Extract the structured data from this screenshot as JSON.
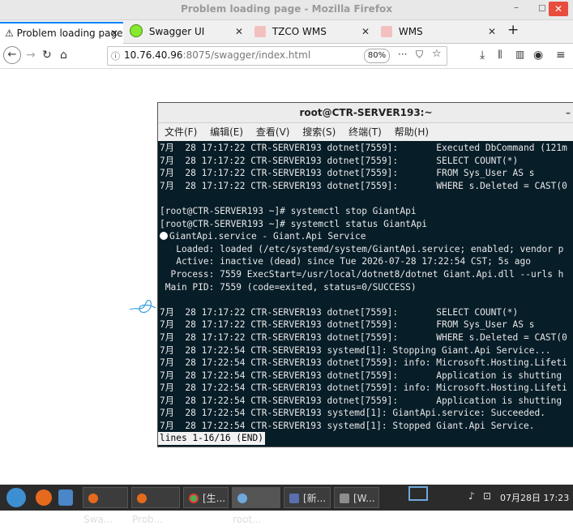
{
  "window": {
    "title": "Problem loading page - Mozilla Firefox",
    "close": "✕",
    "min": "–",
    "max": "◻"
  },
  "tabs": [
    {
      "label": "Problem loading page",
      "icon": "warning-icon",
      "active": true
    },
    {
      "label": "Swagger UI",
      "icon": "swagger-icon",
      "active": false
    },
    {
      "label": "TZCO WMS",
      "icon": "page-icon",
      "active": false
    },
    {
      "label": "WMS",
      "icon": "page-icon",
      "active": false
    }
  ],
  "tab_close": "✕",
  "new_tab": "+",
  "nav": {
    "url_host": "10.76.40.96",
    "url_rest": ":8075/swagger/index.html",
    "zoom": "80%",
    "more": "···"
  },
  "terminal": {
    "title": "root@CTR-SERVER193:~",
    "min": "–",
    "menu": [
      "文件(F)",
      "编辑(E)",
      "查看(V)",
      "搜索(S)",
      "终端(T)",
      "帮助(H)"
    ],
    "lines": [
      "7月  28 17:17:22 CTR-SERVER193 dotnet[7559]:       Executed DbCommand (121m",
      "7月  28 17:17:22 CTR-SERVER193 dotnet[7559]:       SELECT COUNT(*)",
      "7月  28 17:17:22 CTR-SERVER193 dotnet[7559]:       FROM Sys_User AS s",
      "7月  28 17:17:22 CTR-SERVER193 dotnet[7559]:       WHERE s.Deleted = CAST(0",
      "",
      "[root@CTR-SERVER193 ~]# systemctl stop GiantApi",
      "[root@CTR-SERVER193 ~]# systemctl status GiantApi",
      "GiantApi.service - Giant.Api Service",
      "   Loaded: loaded (/etc/systemd/system/GiantApi.service; enabled; vendor p",
      "   Active: inactive (dead) since Tue 2026-07-28 17:22:54 CST; 5s ago",
      "  Process: 7559 ExecStart=/usr/local/dotnet8/dotnet Giant.Api.dll --urls h",
      " Main PID: 7559 (code=exited, status=0/SUCCESS)",
      "",
      "7月  28 17:17:22 CTR-SERVER193 dotnet[7559]:       SELECT COUNT(*)",
      "7月  28 17:17:22 CTR-SERVER193 dotnet[7559]:       FROM Sys_User AS s",
      "7月  28 17:17:22 CTR-SERVER193 dotnet[7559]:       WHERE s.Deleted = CAST(0",
      "7月  28 17:22:54 CTR-SERVER193 systemd[1]: Stopping Giant.Api Service...",
      "7月  28 17:22:54 CTR-SERVER193 dotnet[7559]: info: Microsoft.Hosting.Lifeti",
      "7月  28 17:22:54 CTR-SERVER193 dotnet[7559]:       Application is shutting",
      "7月  28 17:22:54 CTR-SERVER193 dotnet[7559]: info: Microsoft.Hosting.Lifeti",
      "7月  28 17:22:54 CTR-SERVER193 dotnet[7559]:       Application is shutting",
      "7月  28 17:22:54 CTR-SERVER193 systemd[1]: GiantApi.service: Succeeded.",
      "7月  28 17:22:54 CTR-SERVER193 systemd[1]: Stopped Giant.Api Service."
    ],
    "status_line": "lines 1-16/16 (END)"
  },
  "taskbar": {
    "items": [
      {
        "label": "Swa...",
        "icon": "firefox-icon"
      },
      {
        "label": "Prob...",
        "icon": "firefox-icon"
      },
      {
        "label": "[生...",
        "icon": "chrome-icon"
      },
      {
        "label": "root...",
        "icon": "terminal-icon"
      },
      {
        "label": "[新...",
        "icon": "editor-icon"
      },
      {
        "label": "[W...",
        "icon": "folder-icon"
      }
    ],
    "clock": "07月28日 17:23"
  },
  "colors": {
    "terminal_bg": "#071d28",
    "tab_accent": "#0a84ff",
    "close_red": "#e74c3c"
  }
}
